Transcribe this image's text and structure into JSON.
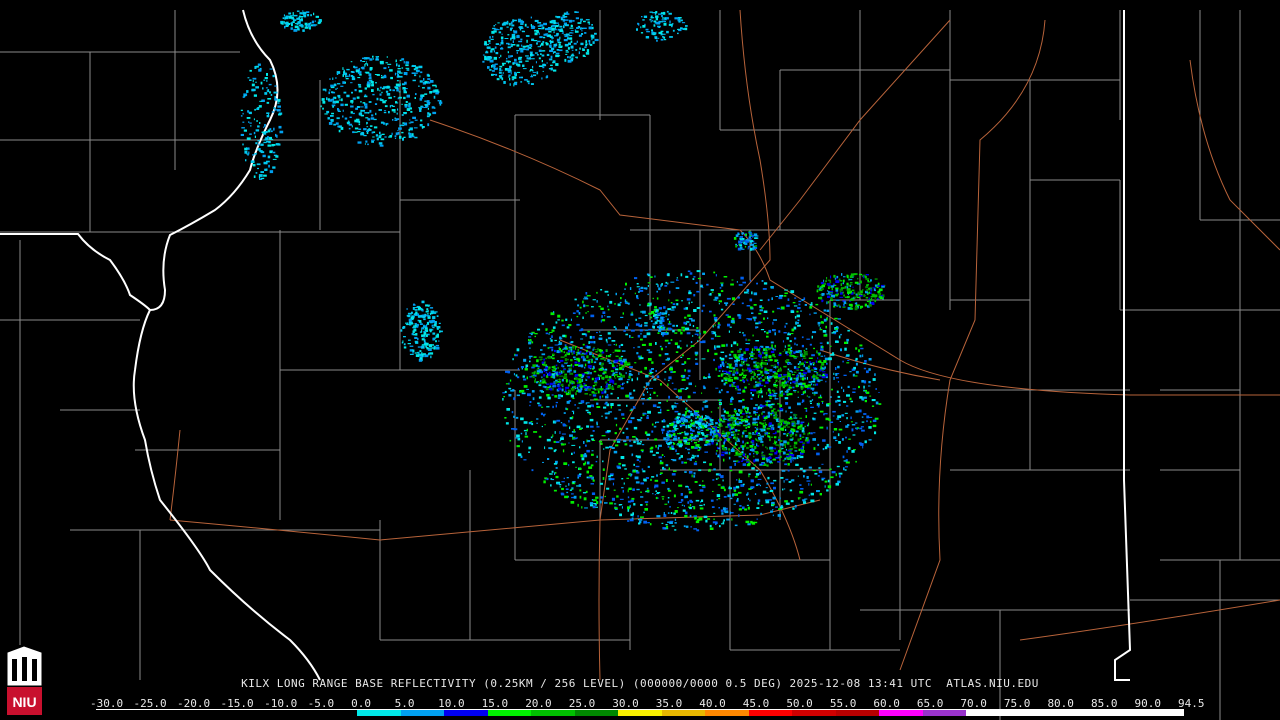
{
  "caption": "KILX LONG RANGE BASE REFLECTIVITY (0.25KM / 256 LEVEL) (000000/0000 0.5 DEG) 2025-12-08 13:41 UTC  ATLAS.NIU.EDU",
  "logo_text": "NIU",
  "scale": {
    "labels": [
      "-30.0",
      "-25.0",
      "-20.0",
      "-15.0",
      "-10.0",
      "-5.0",
      "0.0",
      "5.0",
      "10.0",
      "15.0",
      "20.0",
      "25.0",
      "30.0",
      "35.0",
      "40.0",
      "45.0",
      "50.0",
      "55.0",
      "60.0",
      "65.0",
      "70.0",
      "75.0",
      "80.0",
      "85.0",
      "90.0",
      "94.5"
    ],
    "colors": [
      "#000000",
      "#000000",
      "#000000",
      "#000000",
      "#000000",
      "#000000",
      "#00e8e8",
      "#00a0f0",
      "#0000f0",
      "#00f000",
      "#00c000",
      "#008800",
      "#f8f000",
      "#e8b800",
      "#ff8800",
      "#ff0000",
      "#d00000",
      "#b80000",
      "#ff00ff",
      "#9933cc",
      "#ffffff",
      "#ffffff",
      "#ffffff",
      "#ffffff",
      "#ffffff"
    ]
  },
  "colors": {
    "background": "#000000",
    "county_lines": "#8a8a8a",
    "state_lines": "#ffffff",
    "roads": "#b8633a",
    "logo_red": "#c8102e"
  }
}
